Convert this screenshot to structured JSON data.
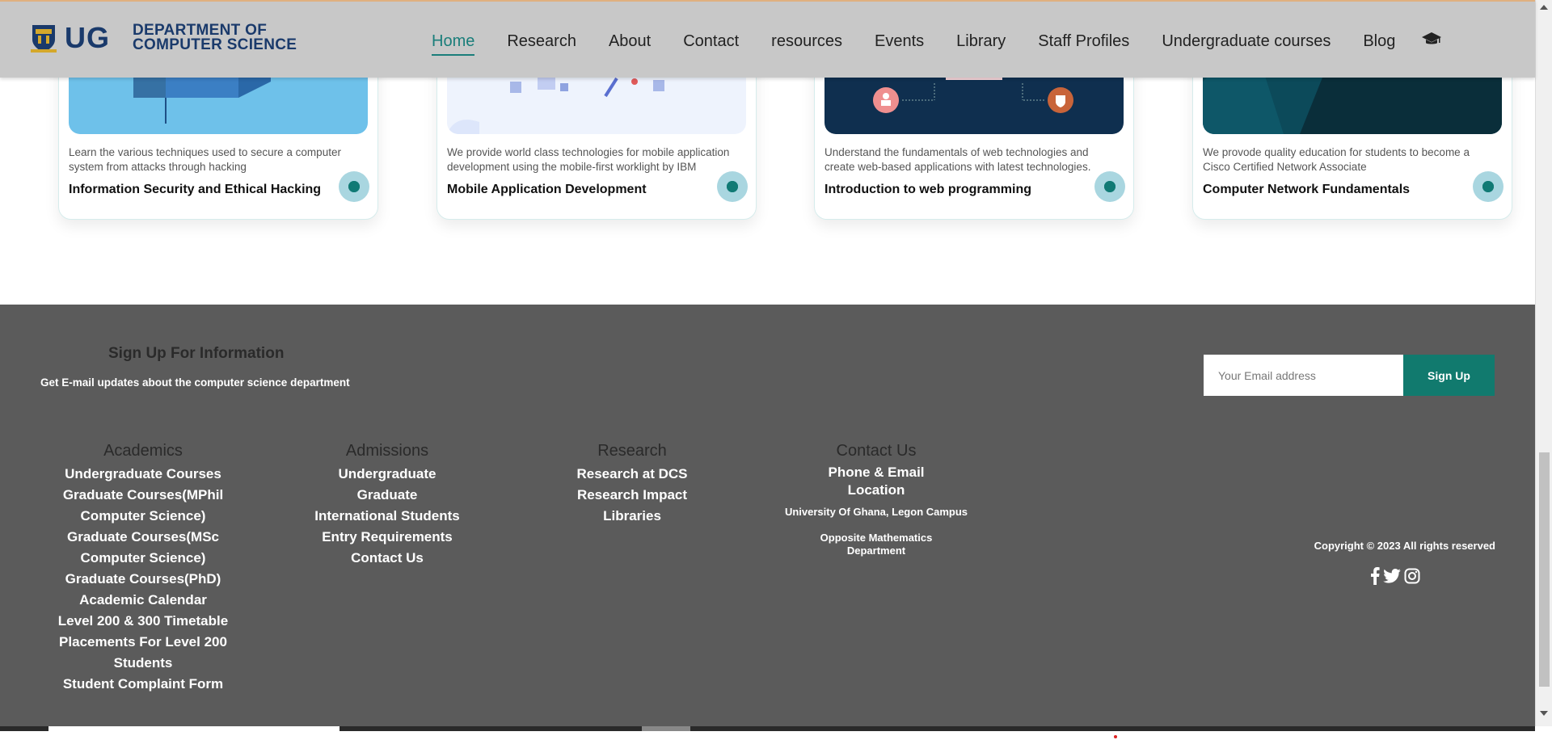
{
  "brand": {
    "logo_text": "UG",
    "dept_line1": "DEPARTMENT OF",
    "dept_line2": "COMPUTER SCIENCE"
  },
  "nav": {
    "items": [
      "Home",
      "Research",
      "About",
      "Contact",
      "resources",
      "Events",
      "Library",
      "Staff Profiles",
      "Undergraduate courses",
      "Blog"
    ],
    "active": "Home",
    "trailing_icon": "graduation-cap-icon"
  },
  "cards": [
    {
      "description": "Learn the various techniques used to secure a computer system from attacks through hacking",
      "title": "Information Security and Ethical Hacking",
      "image_color": "#6ec1ea"
    },
    {
      "description": "We provide world class technologies for mobile application development using the mobile-first worklight by IBM",
      "title": "Mobile Application Development",
      "image_color": "#eef3fd"
    },
    {
      "description": "Understand the fundamentals of web technologies and create web-based applications with latest technologies.",
      "title": "Introduction to web programming",
      "image_color": "#0f2f4f"
    },
    {
      "description": "We provode quality education for students to become a Cisco Certified Network Associate",
      "title": "Computer Network Fundamentals",
      "image_color": "#0c4a5a"
    }
  ],
  "footer": {
    "signup": {
      "title": "Sign Up For Information",
      "subtitle": "Get E-mail updates about the computer science department",
      "email_placeholder": "Your Email address",
      "button_label": "Sign Up"
    },
    "academics": {
      "heading": "Academics",
      "items": [
        "Undergraduate Courses",
        "Graduate Courses(MPhil Computer Science)",
        "Graduate Courses(MSc Computer Science)",
        "Graduate Courses(PhD)",
        "Academic Calendar",
        "Level 200 & 300 Timetable",
        "Placements For Level 200 Students",
        "Student Complaint Form"
      ]
    },
    "admissions": {
      "heading": "Admissions",
      "items": [
        "Undergraduate",
        "Graduate",
        "International Students",
        "Entry Requirements",
        "Contact Us"
      ]
    },
    "research": {
      "heading": "Research",
      "items": [
        "Research at DCS",
        "Research Impact",
        "Libraries"
      ]
    },
    "contact": {
      "heading": "Contact Us",
      "phone_email": "Phone & Email",
      "location": "Location",
      "campus": "University Of Ghana, Legon Campus",
      "landmark": "Opposite Mathematics Department"
    },
    "copyright": "Copyright © 2023 All rights reserved",
    "socials": [
      "facebook-icon",
      "twitter-icon",
      "instagram-icon"
    ]
  },
  "colors": {
    "brand_blue": "#1a3a6b",
    "accent_teal": "#117a6e",
    "footer_bg": "#5b5b5b",
    "nav_bg": "#c8c8c8"
  }
}
